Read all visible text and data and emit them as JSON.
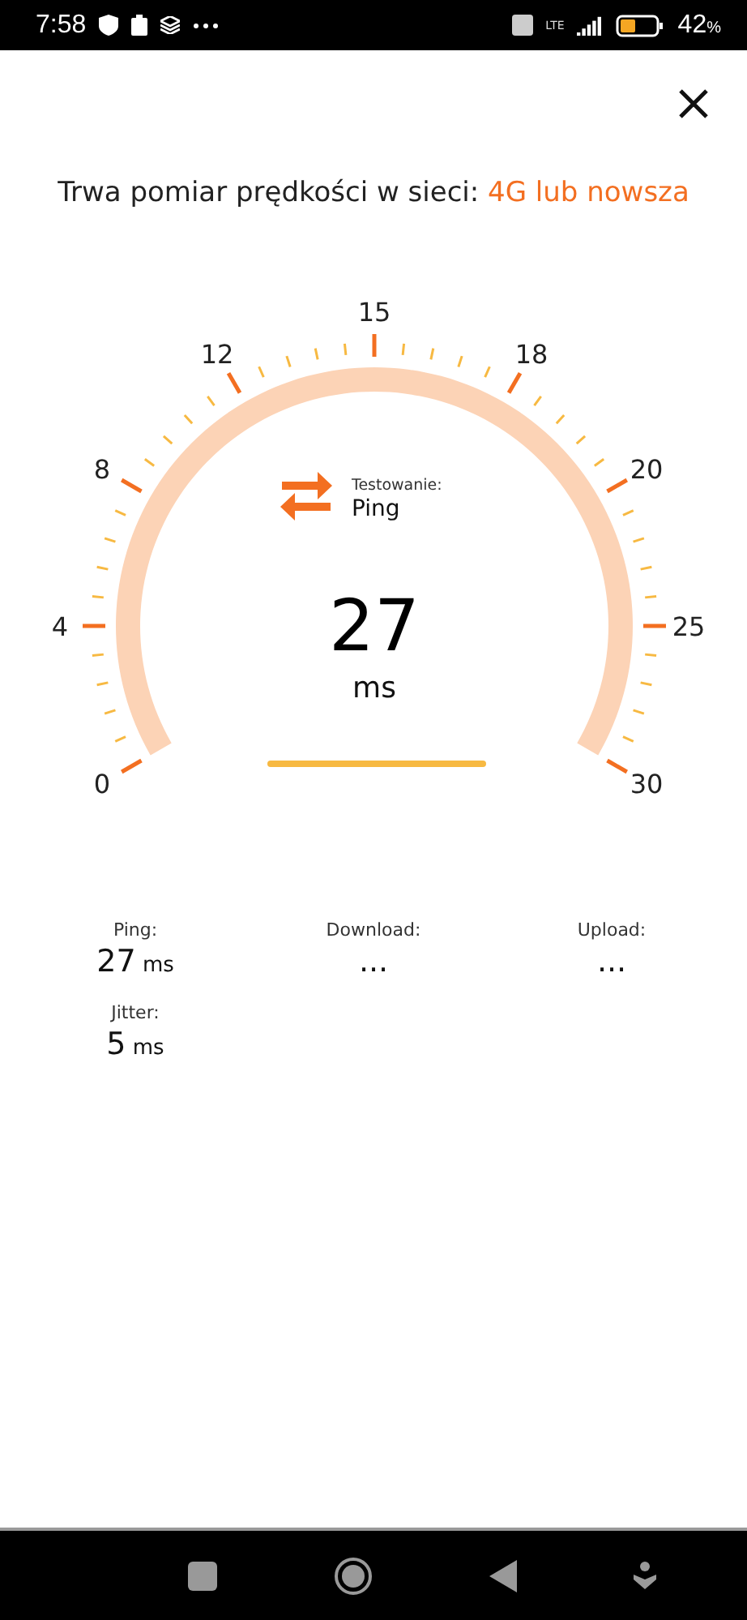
{
  "status_bar": {
    "time": "7:58",
    "network": "LTE",
    "battery": "42",
    "battery_unit": "%"
  },
  "header": {
    "prefix": "Trwa pomiar prędkości w sieci: ",
    "network": "4G lub nowsza"
  },
  "gauge": {
    "ticks": [
      "0",
      "4",
      "8",
      "12",
      "15",
      "18",
      "20",
      "25",
      "30"
    ],
    "phase_label": "Testowanie:",
    "phase": "Ping",
    "value": "27",
    "unit": "ms"
  },
  "results": [
    {
      "label": "Ping:",
      "value": "27",
      "unit": "ms"
    },
    {
      "label": "Download:",
      "value": "..."
    },
    {
      "label": "Upload:",
      "value": "..."
    },
    {
      "label": "Jitter:",
      "value": "5",
      "unit": "ms"
    }
  ]
}
